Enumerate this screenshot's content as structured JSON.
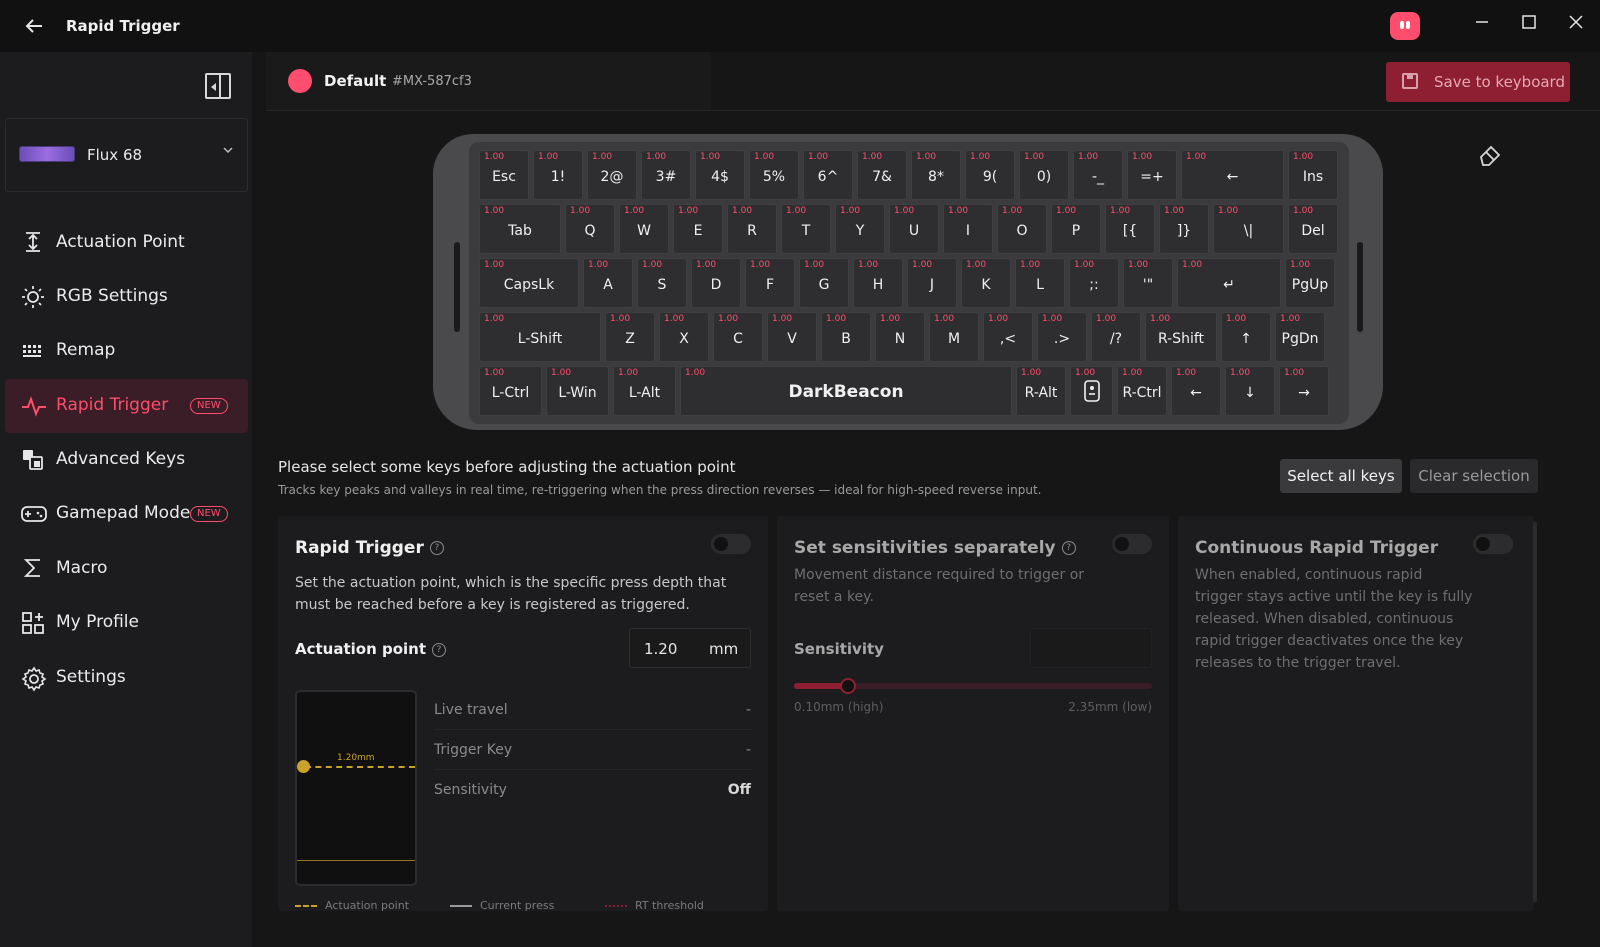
{
  "window": {
    "title": "Rapid Trigger",
    "back_icon": "arrow-left-icon",
    "controls": [
      "minimize-icon",
      "maximize-icon",
      "close-icon"
    ]
  },
  "sidebar": {
    "device_name": "Flux 68",
    "items": [
      {
        "label": "Actuation Point",
        "icon": "actuation-icon"
      },
      {
        "label": "RGB Settings",
        "icon": "sun-icon"
      },
      {
        "label": "Remap",
        "icon": "keyboard-grid-icon"
      },
      {
        "label": "Rapid Trigger",
        "icon": "pulse-icon",
        "badge": "NEW",
        "active": true
      },
      {
        "label": "Advanced Keys",
        "icon": "advanced-keys-icon"
      },
      {
        "label": "Gamepad Mode",
        "icon": "gamepad-icon",
        "badge": "NEW"
      },
      {
        "label": "Macro",
        "icon": "sigma-icon"
      },
      {
        "label": "My Profile",
        "icon": "profile-grid-icon"
      },
      {
        "label": "Settings",
        "icon": "gear-icon"
      }
    ]
  },
  "profile": {
    "name": "Default",
    "id": "#MX-587cf3",
    "color": "#ff4d6d",
    "save_label": "Save to keyboard"
  },
  "keyboard": {
    "default_value": "1.00",
    "rows": [
      [
        "Esc",
        "1!",
        "2@",
        "3#",
        "4$",
        "5%",
        "6^",
        "7&",
        "8*",
        "9(",
        "0)",
        "-_",
        "=+",
        "←",
        "Ins"
      ],
      [
        "Tab",
        "Q",
        "W",
        "E",
        "R",
        "T",
        "Y",
        "U",
        "I",
        "O",
        "P",
        "[{",
        "]}",
        "\\|",
        "Del"
      ],
      [
        "CapsLk",
        "A",
        "S",
        "D",
        "F",
        "G",
        "H",
        "J",
        "K",
        "L",
        ";:",
        "'\"",
        "↵",
        "PgUp"
      ],
      [
        "L-Shift",
        "Z",
        "X",
        "C",
        "V",
        "B",
        "N",
        "M",
        ",<",
        ".>",
        "/?",
        "R-Shift",
        "↑",
        "PgDn"
      ],
      [
        "L-Ctrl",
        "L-Win",
        "L-Alt",
        "DarkBeacon",
        "R-Alt",
        "Fn",
        "R-Ctrl",
        "←",
        "↓",
        "→"
      ]
    ]
  },
  "info": {
    "title": "Please select some keys before adjusting the actuation point",
    "subtitle": "Tracks key peaks and valleys in real time, re-triggering when the press direction reverses — ideal for high-speed reverse input.",
    "select_all": "Select all keys",
    "clear": "Clear selection"
  },
  "panel_rt": {
    "title": "Rapid Trigger",
    "desc": "Set the actuation point, which is the specific press depth that must be reached before a key is registered as triggered.",
    "actuation_label": "Actuation point",
    "actuation_value": "1.20",
    "actuation_unit": "mm",
    "viz_label": "1.20mm",
    "stats": [
      {
        "label": "Live travel",
        "value": "-"
      },
      {
        "label": "Trigger Key",
        "value": "-"
      },
      {
        "label": "Sensitivity",
        "value": "Off"
      }
    ],
    "legend": [
      "Actuation point",
      "Current press",
      "RT threshold"
    ]
  },
  "panel_sens": {
    "title": "Set sensitivities separately",
    "desc": "Movement distance required to trigger or reset a key.",
    "sens_label": "Sensitivity",
    "slider_fraction": 0.15,
    "min_label": "0.10mm (high)",
    "max_label": "2.35mm (low)"
  },
  "panel_cont": {
    "title": "Continuous Rapid Trigger",
    "desc": "When enabled, continuous rapid trigger stays active until the key is fully released. When disabled, continuous rapid trigger deactivates once the key releases to the trigger travel."
  }
}
